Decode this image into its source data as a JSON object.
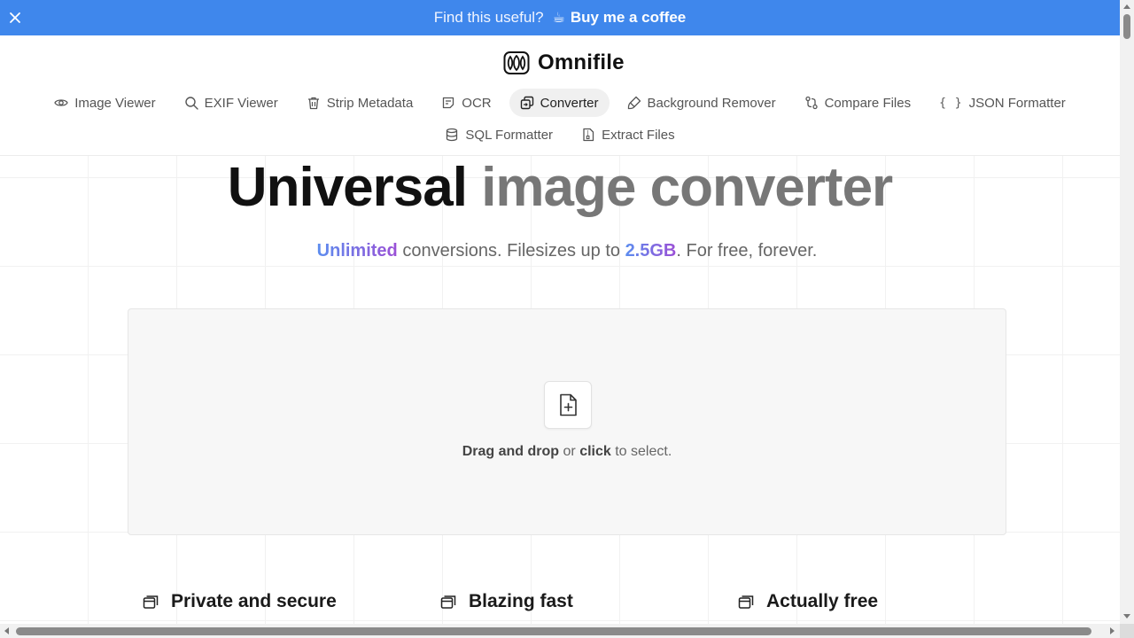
{
  "promo": {
    "question": "Find this useful?",
    "coffee_glyph": "☕",
    "cta": "Buy me a coffee",
    "close_icon": "close-icon",
    "color": "#3f87ec"
  },
  "brand": {
    "name": "Omnifile",
    "logo_icon": "omnifile-logo-icon"
  },
  "nav": {
    "row1": [
      {
        "label": "Image Viewer",
        "icon": "eye-icon"
      },
      {
        "label": "EXIF Viewer",
        "icon": "search-icon"
      },
      {
        "label": "Strip Metadata",
        "icon": "trash-icon"
      },
      {
        "label": "OCR",
        "icon": "scan-text-icon"
      },
      {
        "label": "Converter",
        "icon": "converter-icon",
        "active": true
      },
      {
        "label": "Background Remover",
        "icon": "brush-icon"
      },
      {
        "label": "Compare Files",
        "icon": "git-compare-icon"
      },
      {
        "label": "JSON Formatter",
        "icon": "braces-icon",
        "glyph": "{ }"
      }
    ],
    "row2": [
      {
        "label": "SQL Formatter",
        "icon": "database-icon"
      },
      {
        "label": "Extract Files",
        "icon": "file-archive-icon"
      }
    ]
  },
  "hero": {
    "title_dark": "Universal",
    "title_light": "image converter",
    "subtitle": {
      "highlight1": "Unlimited",
      "text1": " conversions. Filesizes up to ",
      "highlight2": "2.5GB",
      "text2": ". For free, forever."
    }
  },
  "dropzone": {
    "icon": "file-plus-icon",
    "bold1": "Drag and drop",
    "text1": " or ",
    "bold2": "click",
    "text2": " to select."
  },
  "features": [
    {
      "title": "Private and secure",
      "icon": "window-icon"
    },
    {
      "title": "Blazing fast",
      "icon": "window-icon"
    },
    {
      "title": "Actually free",
      "icon": "window-icon"
    }
  ],
  "colors": {
    "accent_blue": "#5c8def",
    "accent_purple": "#9b4fd6"
  }
}
